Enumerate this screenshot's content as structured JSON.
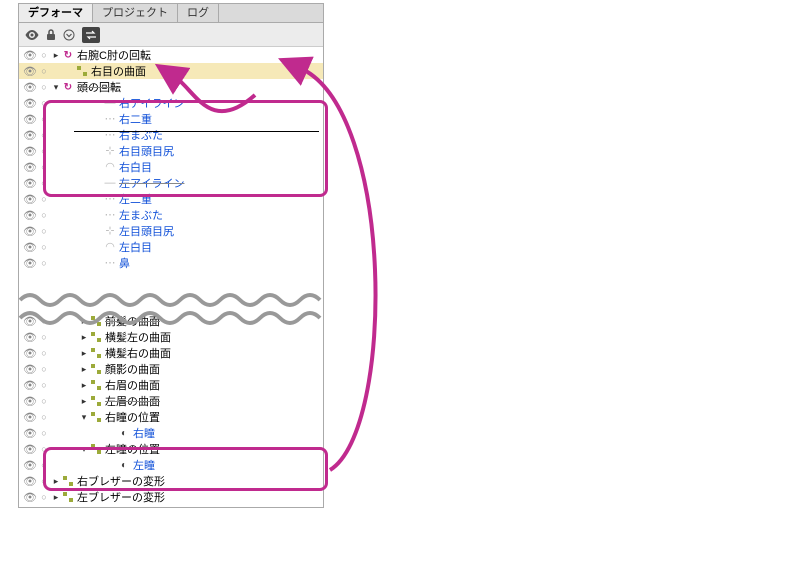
{
  "tabs": {
    "t0": "デフォーマ",
    "t1": "プロジェクト",
    "t2": "ログ"
  },
  "tree_top": {
    "r0": "右腕C肘の回転",
    "r1": "右目の曲面",
    "r2": "頭の回転",
    "r3": "右アイライン",
    "r4": "右二重",
    "r5": "右まぶた",
    "r6": "右目頭目尻",
    "r7": "右白目",
    "r8": "左アイライン",
    "r9": "左二重",
    "r10": "左まぶた",
    "r11": "左目頭目尻",
    "r12": "左白目",
    "r13": "鼻"
  },
  "tree_bot": {
    "b0": "前髪の曲面",
    "b1": "横髪左の曲面",
    "b2": "横髪右の曲面",
    "b3": "顔影の曲面",
    "b4": "右眉の曲面",
    "b5": "左眉の曲面",
    "b6": "右瞳の位置",
    "b7": "右瞳",
    "b8": "左瞳の位置",
    "b9": "左瞳",
    "b10": "右ブレザーの変形",
    "b11": "左ブレザーの変形"
  }
}
